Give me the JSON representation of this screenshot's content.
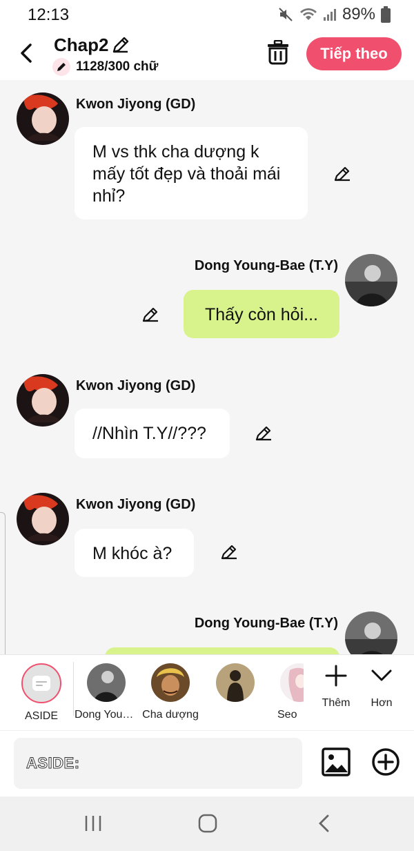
{
  "status": {
    "time": "12:13",
    "battery": "89%"
  },
  "header": {
    "title": "Chap2",
    "char_count": "1128/300 chữ",
    "next_label": "Tiếp theo"
  },
  "messages": [
    {
      "side": "left",
      "name": "Kwon Jiyong (GD)",
      "text": "M vs thk cha dượng k mấy tốt đẹp và thoải mái nhỉ?"
    },
    {
      "side": "right",
      "name": "Dong Young-Bae (T.Y)",
      "text": "Thấy còn hỏi..."
    },
    {
      "side": "left",
      "name": "Kwon Jiyong (GD)",
      "text": "//Nhìn T.Y//???"
    },
    {
      "side": "left",
      "name": "Kwon Jiyong (GD)",
      "text": "M khóc à?"
    },
    {
      "side": "right",
      "name": "Dong Young-Bae (T.Y)",
      "text": ""
    }
  ],
  "characters": [
    {
      "label": "ASIDE"
    },
    {
      "label": "Dong Young-Bae (T.Y)"
    },
    {
      "label": "Cha dượng"
    },
    {
      "label": ""
    },
    {
      "label": "Seo"
    }
  ],
  "more": {
    "add_label": "Thêm",
    "more_label": "Hơn"
  },
  "input": {
    "placeholder": "ASIDE:"
  },
  "colors": {
    "accent": "#f0506e",
    "right_bubble": "#d9f38c",
    "left_bubble": "#ffffff",
    "background": "#f5f5f5"
  }
}
